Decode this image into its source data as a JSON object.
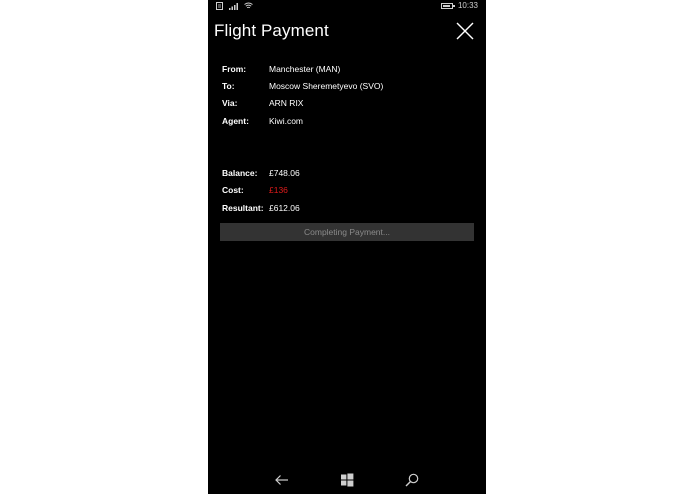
{
  "status_bar": {
    "time": "10:33",
    "icons": [
      "notification-icon",
      "signal-icon",
      "wifi-icon",
      "battery-icon"
    ]
  },
  "header": {
    "title": "Flight Payment",
    "close_icon": "close-icon"
  },
  "flight": {
    "from_label": "From:",
    "from_value": "Manchester (MAN)",
    "to_label": "To:",
    "to_value": "Moscow Sheremetyevo (SVO)",
    "via_label": "Via:",
    "via_value": "ARN RIX",
    "agent_label": "Agent:",
    "agent_value": "Kiwi.com"
  },
  "payment": {
    "balance_label": "Balance:",
    "balance_value": "£748.06",
    "cost_label": "Cost:",
    "cost_value": "£136",
    "resultant_label": "Resultant:",
    "resultant_value": "£612.06",
    "button_label": "Completing Payment..."
  },
  "colors": {
    "background": "#000000",
    "text": "#ffffff",
    "cost": "#e01b1b",
    "button_bg": "#333333",
    "button_text": "#8a8a8a"
  },
  "nav_bar": {
    "icons": [
      "back-arrow-icon",
      "windows-start-icon",
      "search-icon"
    ]
  }
}
